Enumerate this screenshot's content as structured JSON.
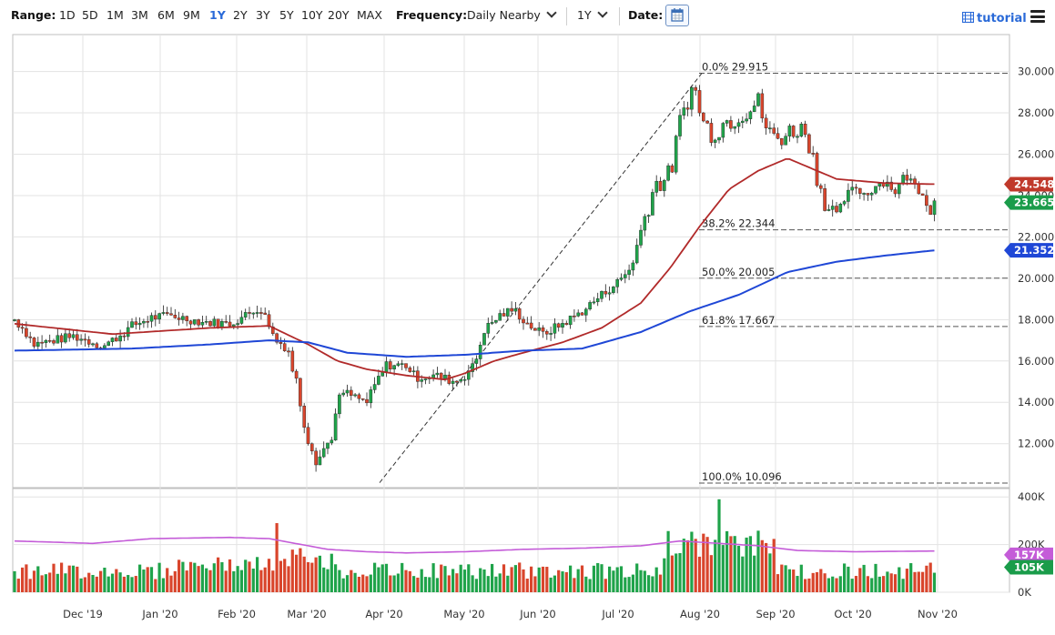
{
  "toolbar": {
    "range_label": "Range:",
    "ranges": [
      "1D",
      "5D",
      "1M",
      "3M",
      "6M",
      "9M",
      "1Y",
      "2Y",
      "3Y",
      "5Y",
      "10Y",
      "20Y",
      "MAX"
    ],
    "active_range": "1Y",
    "frequency_label": "Frequency:",
    "frequency_value": "Daily Nearby",
    "period_value": "1Y",
    "date_label": "Date:",
    "tutorial_label": "tutorial",
    "accent_color": "#2a6ad8"
  },
  "chart_data": {
    "type": "candlestick",
    "x_ticks": [
      "Dec '19",
      "Jan '20",
      "Feb '20",
      "Mar '20",
      "Apr '20",
      "May '20",
      "Jun '20",
      "Jul '20",
      "Aug '20",
      "Sep '20",
      "Oct '20",
      "Nov '20"
    ],
    "y_ticks": [
      "12.000",
      "14.000",
      "16.000",
      "18.000",
      "20.000",
      "22.000",
      "24.000",
      "26.000",
      "28.000",
      "30.000"
    ],
    "ylim": [
      10.096,
      29.915
    ],
    "volume_ticks": [
      "0K",
      "200K",
      "400K"
    ],
    "volume_ylim": [
      0,
      400
    ],
    "grid": true,
    "fib_levels": [
      {
        "label": "0.0% 29.915",
        "value": 29.915
      },
      {
        "label": "38.2% 22.344",
        "value": 22.344
      },
      {
        "label": "50.0% 20.005",
        "value": 20.005
      },
      {
        "label": "61.8% 17.667",
        "value": 17.667
      },
      {
        "label": "100.0% 10.096",
        "value": 10.096
      }
    ],
    "trendline": {
      "from": {
        "x": "Apr '20",
        "y": 10.2
      },
      "to": {
        "x": "Aug '20",
        "y": 29.915
      }
    },
    "price_badges": [
      {
        "text": "24.548",
        "value": 24.548,
        "color": "#c0392b"
      },
      {
        "text": "23.665",
        "value": 23.665,
        "color": "#1a9c4a"
      },
      {
        "text": "21.352",
        "value": 21.352,
        "color": "#1f47d6"
      }
    ],
    "volume_badges": [
      {
        "text": "157K",
        "value": 157,
        "color": "#c45cd8"
      },
      {
        "text": "105K",
        "value": 105,
        "color": "#1a9c4a"
      }
    ],
    "colors": {
      "up": "#1fa34a",
      "down": "#d9452c",
      "ma50": "#b12a2a",
      "ma200": "#1f47d6",
      "vol_ma": "#c45cd8"
    },
    "price_anchors": [
      [
        0,
        18.0
      ],
      [
        5,
        17.5
      ],
      [
        10,
        16.8
      ],
      [
        20,
        17.0
      ],
      [
        30,
        17.2
      ],
      [
        40,
        16.9
      ],
      [
        45,
        16.7
      ],
      [
        55,
        17.3
      ],
      [
        60,
        17.7
      ],
      [
        70,
        18.1
      ],
      [
        80,
        18.2
      ],
      [
        95,
        17.9
      ],
      [
        110,
        17.8
      ],
      [
        120,
        18.3
      ],
      [
        125,
        18.6
      ],
      [
        130,
        17.8
      ],
      [
        133,
        17.0
      ],
      [
        137,
        16.8
      ],
      [
        140,
        16.5
      ],
      [
        145,
        14.5
      ],
      [
        150,
        12.5
      ],
      [
        155,
        11.3
      ],
      [
        160,
        12.0
      ],
      [
        168,
        14.5
      ],
      [
        175,
        14.2
      ],
      [
        180,
        14.0
      ],
      [
        185,
        15.0
      ],
      [
        190,
        15.8
      ],
      [
        200,
        15.8
      ],
      [
        205,
        15.2
      ],
      [
        215,
        15.3
      ],
      [
        225,
        15.0
      ],
      [
        230,
        15.3
      ],
      [
        235,
        15.8
      ],
      [
        240,
        17.5
      ],
      [
        248,
        18.2
      ],
      [
        255,
        18.5
      ],
      [
        262,
        17.8
      ],
      [
        270,
        17.3
      ],
      [
        280,
        17.8
      ],
      [
        290,
        18.4
      ],
      [
        300,
        19.2
      ],
      [
        308,
        19.8
      ],
      [
        315,
        20.5
      ],
      [
        322,
        23.0
      ],
      [
        327,
        24.5
      ],
      [
        335,
        25.0
      ],
      [
        340,
        27.5
      ],
      [
        343,
        28.5
      ],
      [
        347,
        29.3
      ],
      [
        352,
        27.5
      ],
      [
        357,
        27.0
      ],
      [
        362,
        27.5
      ],
      [
        368,
        27.8
      ],
      [
        375,
        28.2
      ],
      [
        380,
        28.5
      ],
      [
        385,
        27.0
      ],
      [
        390,
        26.8
      ],
      [
        395,
        27.0
      ],
      [
        400,
        27.3
      ],
      [
        405,
        27.0
      ],
      [
        410,
        25.0
      ],
      [
        415,
        23.5
      ],
      [
        420,
        23.0
      ],
      [
        425,
        24.0
      ],
      [
        430,
        24.4
      ],
      [
        435,
        24.0
      ],
      [
        440,
        24.5
      ],
      [
        445,
        24.7
      ],
      [
        450,
        24.2
      ],
      [
        455,
        25.0
      ],
      [
        460,
        24.5
      ],
      [
        465,
        24.0
      ],
      [
        468,
        23.2
      ],
      [
        470,
        23.7
      ]
    ],
    "ma50_anchors": [
      [
        0,
        17.8
      ],
      [
        50,
        17.3
      ],
      [
        100,
        17.6
      ],
      [
        130,
        17.7
      ],
      [
        150,
        16.8
      ],
      [
        165,
        16.0
      ],
      [
        180,
        15.6
      ],
      [
        200,
        15.3
      ],
      [
        220,
        15.1
      ],
      [
        230,
        15.4
      ],
      [
        245,
        16.0
      ],
      [
        260,
        16.4
      ],
      [
        280,
        16.9
      ],
      [
        300,
        17.6
      ],
      [
        320,
        18.8
      ],
      [
        335,
        20.5
      ],
      [
        350,
        22.5
      ],
      [
        365,
        24.3
      ],
      [
        380,
        25.2
      ],
      [
        395,
        25.8
      ],
      [
        405,
        25.4
      ],
      [
        420,
        24.8
      ],
      [
        445,
        24.6
      ],
      [
        470,
        24.55
      ]
    ],
    "ma200_anchors": [
      [
        0,
        16.5
      ],
      [
        60,
        16.6
      ],
      [
        100,
        16.8
      ],
      [
        130,
        17.0
      ],
      [
        150,
        16.9
      ],
      [
        170,
        16.4
      ],
      [
        200,
        16.2
      ],
      [
        230,
        16.3
      ],
      [
        260,
        16.5
      ],
      [
        290,
        16.6
      ],
      [
        320,
        17.4
      ],
      [
        345,
        18.4
      ],
      [
        370,
        19.2
      ],
      [
        395,
        20.3
      ],
      [
        420,
        20.8
      ],
      [
        445,
        21.1
      ],
      [
        470,
        21.35
      ]
    ],
    "vol_ma_anchors": [
      [
        0,
        215
      ],
      [
        40,
        205
      ],
      [
        70,
        225
      ],
      [
        110,
        230
      ],
      [
        130,
        225
      ],
      [
        140,
        210
      ],
      [
        160,
        180
      ],
      [
        180,
        170
      ],
      [
        200,
        165
      ],
      [
        230,
        170
      ],
      [
        260,
        180
      ],
      [
        290,
        185
      ],
      [
        320,
        195
      ],
      [
        340,
        215
      ],
      [
        360,
        205
      ],
      [
        380,
        195
      ],
      [
        400,
        175
      ],
      [
        430,
        170
      ],
      [
        470,
        173
      ]
    ]
  }
}
